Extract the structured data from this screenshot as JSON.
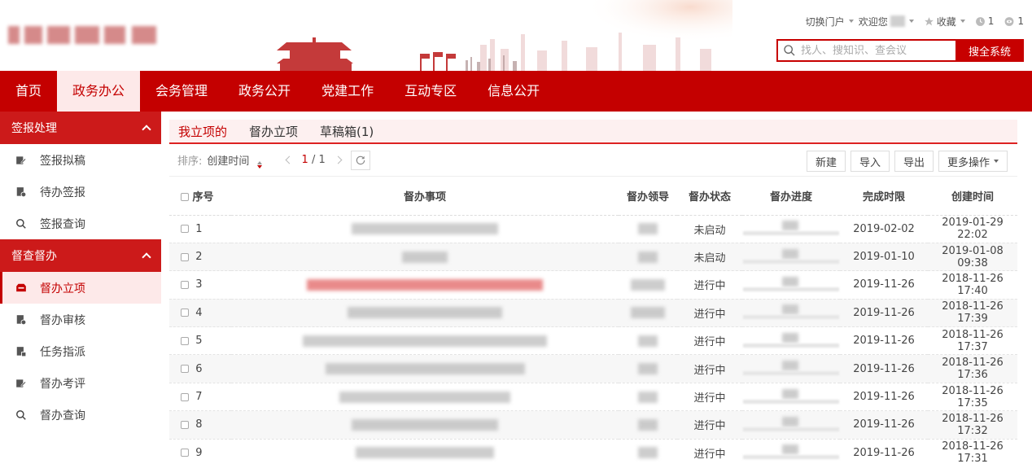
{
  "header": {
    "switch_portal": "切换门户",
    "welcome": "欢迎您",
    "favorites": "收藏",
    "count_a": "1",
    "count_b": "1",
    "search_placeholder": "找人、搜知识、查会议",
    "search_button": "搜全系统"
  },
  "nav": [
    "首页",
    "政务办公",
    "会务管理",
    "政务公开",
    "党建工作",
    "互动专区",
    "信息公开"
  ],
  "sidebar": {
    "group1": {
      "title": "签报处理",
      "items": [
        {
          "label": "签报拟稿",
          "icon": "edit-icon"
        },
        {
          "label": "待办签报",
          "icon": "doc-pending-icon"
        },
        {
          "label": "签报查询",
          "icon": "search-icon"
        }
      ]
    },
    "group2": {
      "title": "督查督办",
      "items": [
        {
          "label": "督办立项",
          "icon": "inbox-icon"
        },
        {
          "label": "督办审核",
          "icon": "doc-review-icon"
        },
        {
          "label": "任务指派",
          "icon": "doc-assign-icon"
        },
        {
          "label": "督办考评",
          "icon": "edit-icon"
        },
        {
          "label": "督办查询",
          "icon": "search-icon"
        }
      ]
    }
  },
  "tabs": [
    "我立项的",
    "督办立项",
    "草稿箱(1)"
  ],
  "toolbar": {
    "sort_label": "排序:",
    "sort_value": "创建时间",
    "page_current": "1",
    "page_total": "/ 1",
    "buttons": [
      "新建",
      "导入",
      "导出",
      "更多操作"
    ]
  },
  "table": {
    "headers": [
      "序号",
      "督办事项",
      "督办领导",
      "督办状态",
      "督办进度",
      "完成时限",
      "创建时间"
    ],
    "rows": [
      {
        "no": "1",
        "status": "未启动",
        "deadline": "2019-02-02",
        "created": "2019-01-29 22:02"
      },
      {
        "no": "2",
        "status": "未启动",
        "deadline": "2019-01-10",
        "created": "2019-01-08 09:38"
      },
      {
        "no": "3",
        "status": "进行中",
        "deadline": "2019-11-26",
        "created": "2018-11-26 17:40"
      },
      {
        "no": "4",
        "status": "进行中",
        "deadline": "2019-11-26",
        "created": "2018-11-26 17:39"
      },
      {
        "no": "5",
        "status": "进行中",
        "deadline": "2019-11-26",
        "created": "2018-11-26 17:37"
      },
      {
        "no": "6",
        "status": "进行中",
        "deadline": "2019-11-26",
        "created": "2018-11-26 17:36"
      },
      {
        "no": "7",
        "status": "进行中",
        "deadline": "2019-11-26",
        "created": "2018-11-26 17:35"
      },
      {
        "no": "8",
        "status": "进行中",
        "deadline": "2019-11-26",
        "created": "2018-11-26 17:32"
      },
      {
        "no": "9",
        "status": "进行中",
        "deadline": "2019-11-26",
        "created": "2018-11-26 17:31"
      }
    ]
  },
  "colors": {
    "brand": "#c40000",
    "active_bg": "#fde9e9"
  }
}
